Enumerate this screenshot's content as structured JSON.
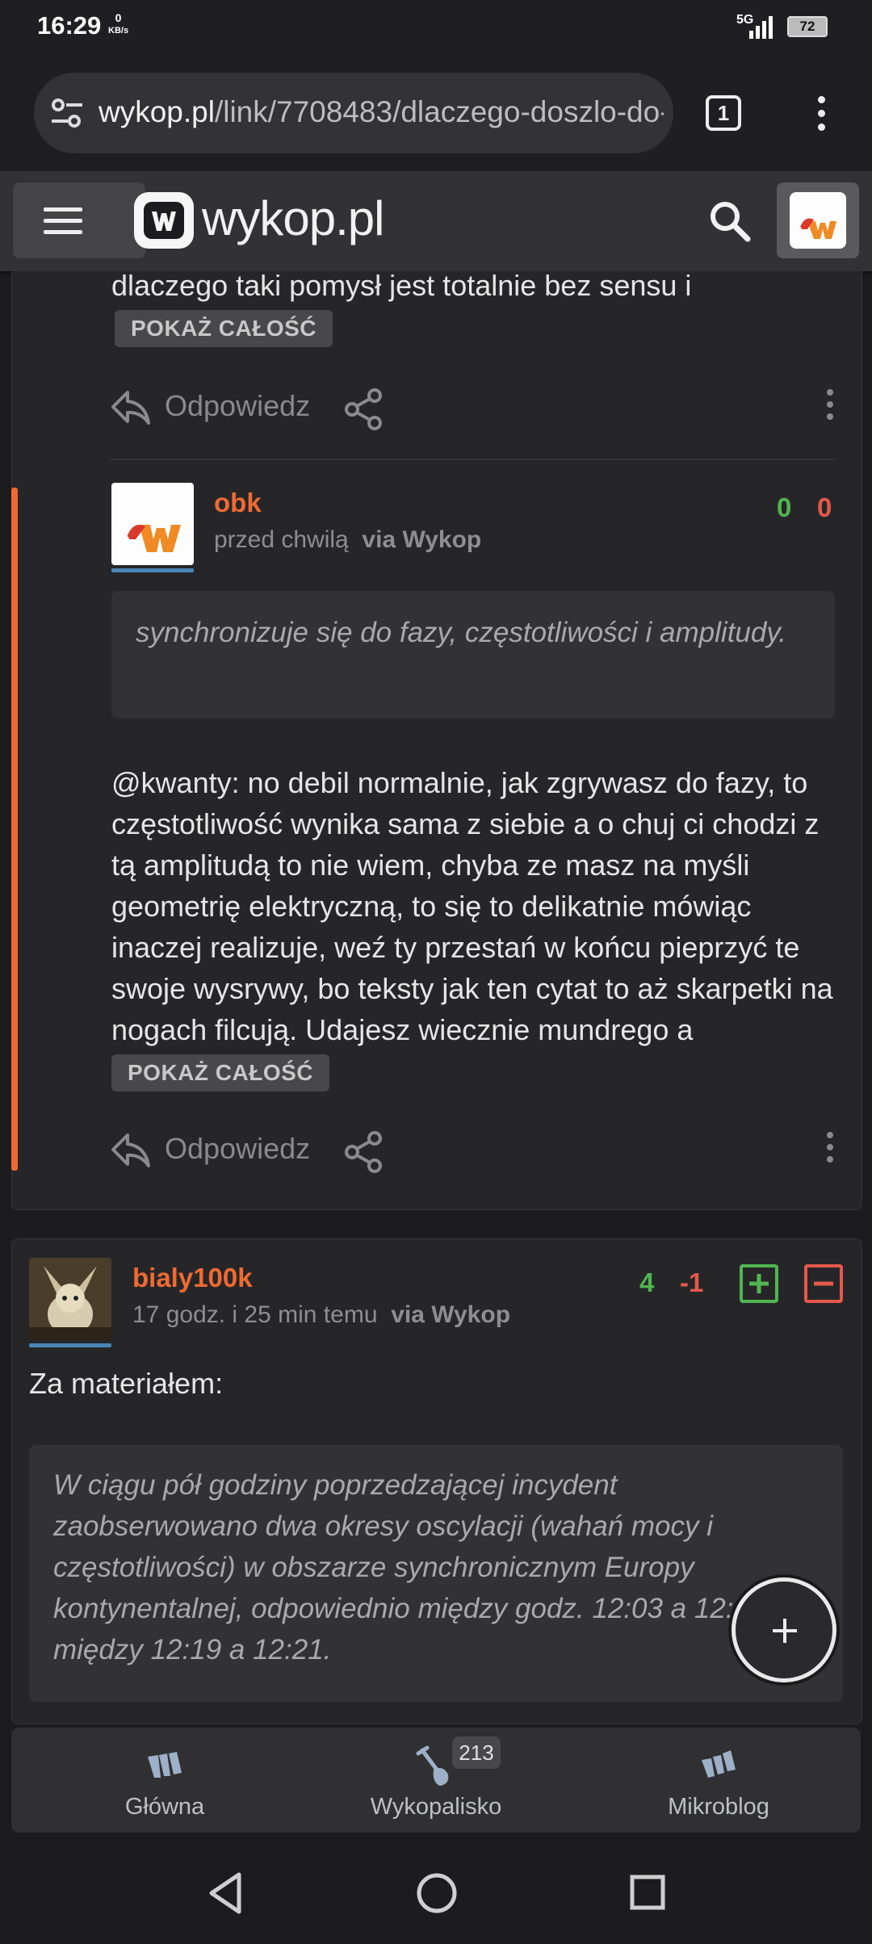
{
  "status_bar": {
    "time": "16:29",
    "net_speed_value": "0",
    "net_speed_unit": "KB/s",
    "network_type": "5G",
    "battery": "72"
  },
  "browser": {
    "url_host": "wykop.pl",
    "url_path": "/link/7708483/dlaczego-doszlo-do-",
    "tab_count": "1"
  },
  "site": {
    "logo_text": "wykop.pl"
  },
  "comments": [
    {
      "truncated_text": "dlaczego taki pomysł jest totalnie bez sensu i",
      "show_all": "POKAŻ CAŁOŚĆ",
      "reply_label": "Odpowiedz"
    },
    {
      "author": "obk",
      "time": "przed chwilą",
      "via": "via Wykop",
      "votes_up": "0",
      "votes_down": "0",
      "quote": "synchronizuje się do fazy, częstotliwości i amplitudy.",
      "mention": "@kwanty",
      "text": ": no debil normalnie, jak zgrywasz do fazy, to częstotliwość wynika sama z siebie a o chuj ci chodzi z tą amplitudą to nie wiem, chyba ze masz na myśli geometrię elektryczną, to się to delikatnie mówiąc inaczej realizuje, weź ty przestań w końcu pieprzyć te swoje wysrywy, bo teksty jak ten cytat to aż skarpetki na nogach filcują. Udajesz wiecznie mundrego a",
      "show_all": "POKAŻ CAŁOŚĆ",
      "reply_label": "Odpowiedz"
    },
    {
      "author": "bialy100k",
      "time": "17 godz. i 25 min temu",
      "via": "via Wykop",
      "votes_up": "4",
      "votes_down": "-1",
      "text": "Za materiałem:",
      "quote": "W ciągu pół godziny poprzedzającej incydent zaobserwowano dwa okresy oscylacji (wahań mocy i częstotliwości) w obszarze synchronicznym Europy kontynentalnej, odpowiednio między godz. 12:03 a 12:07 i między 12:19 a 12:21."
    }
  ],
  "bottom_nav": {
    "items": [
      "Główna",
      "Wykopalisko",
      "Mikroblog"
    ],
    "badge": "213"
  },
  "colors": {
    "accent": "#ef6a33",
    "vote_up": "#51b552",
    "vote_down": "#e5584c",
    "background": "#1c1c1e",
    "card": "#262628"
  }
}
